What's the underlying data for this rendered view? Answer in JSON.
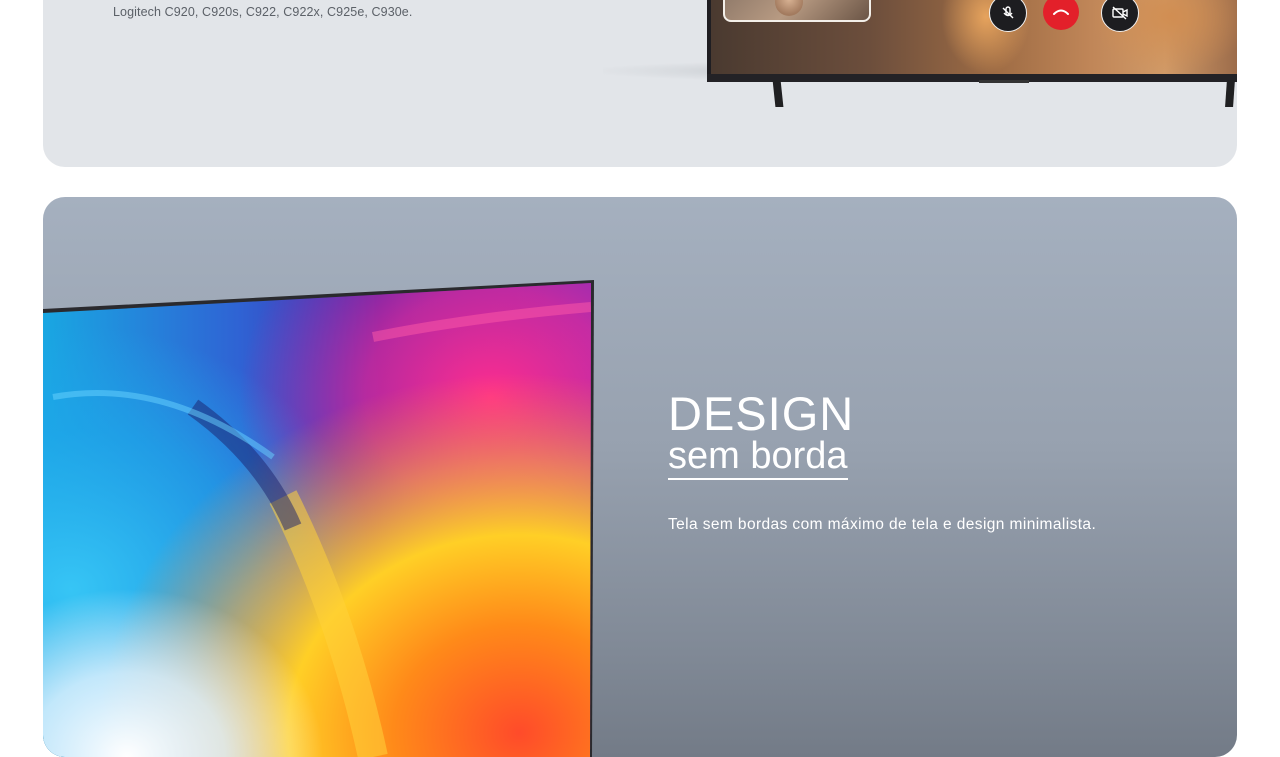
{
  "compat": {
    "text": "Logitech C920, C920s, C922, C922x, C925e, C930e."
  },
  "video_call": {
    "buttons": [
      {
        "icon": "mic-off-icon"
      },
      {
        "icon": "end-call-icon"
      },
      {
        "icon": "camera-off-icon"
      }
    ],
    "end_call_color": "#e3202a"
  },
  "design_section": {
    "title": "DESIGN",
    "subtitle": "sem borda",
    "description": "Tela sem bordas com máximo de tela e design minimalista."
  },
  "colors": {
    "top_card_bg": "#e2e5e9",
    "bottom_card_gradient": [
      "#a5b0bf",
      "#737b87"
    ],
    "text_light": "#ffffff",
    "text_dark": "#5c6168"
  }
}
